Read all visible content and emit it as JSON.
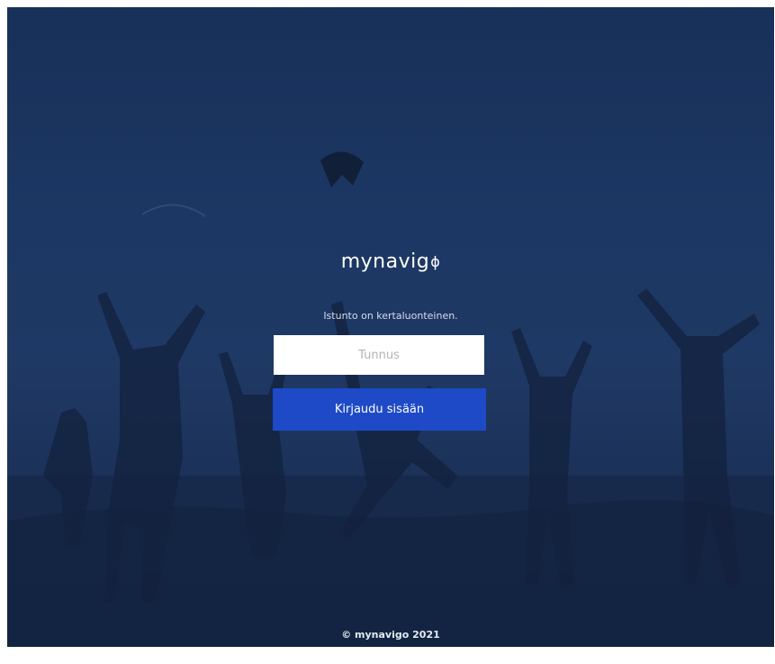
{
  "brand": {
    "name": "mynavig",
    "mark": "ϕ"
  },
  "login": {
    "session_message": "Istunto on kertaluonteinen.",
    "username_placeholder": "Tunnus",
    "username_value": "",
    "submit_label": "Kirjaudu sisään"
  },
  "footer": {
    "copyright": "© mynavigo 2021"
  },
  "colors": {
    "background": "#1f3d6c",
    "button": "#1e4ac7",
    "input_background": "#ffffff",
    "text": "#ffffff"
  }
}
